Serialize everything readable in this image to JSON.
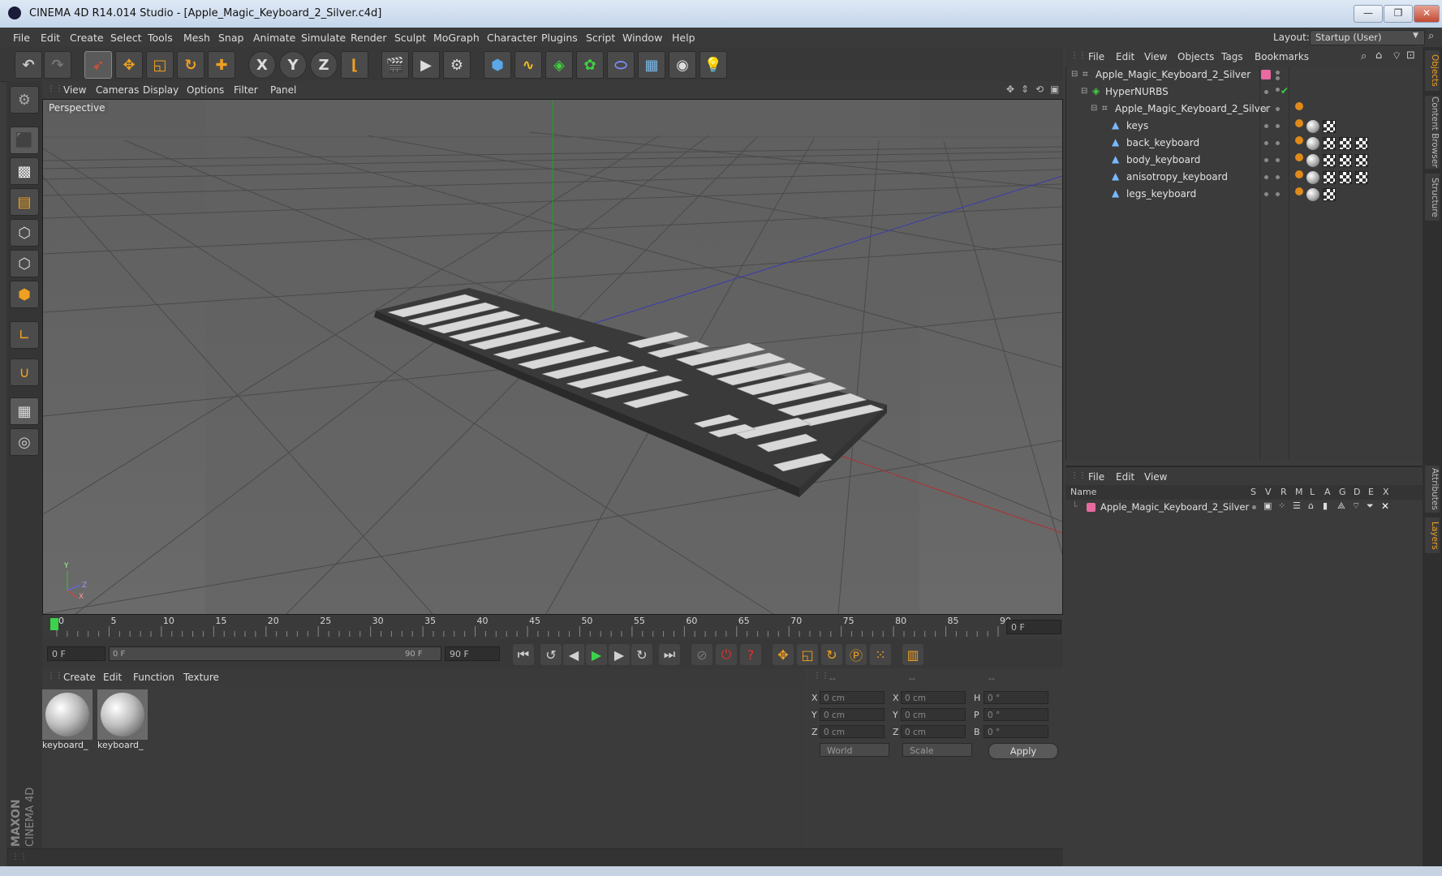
{
  "window": {
    "title": "CINEMA 4D R14.014 Studio - [Apple_Magic_Keyboard_2_Silver.c4d]",
    "controls": {
      "minimize": "—",
      "restore": "❐",
      "close": "✕"
    }
  },
  "menubar": {
    "items": [
      "File",
      "Edit",
      "Create",
      "Select",
      "Tools",
      "Mesh",
      "Snap",
      "Animate",
      "Simulate",
      "Render",
      "Sculpt",
      "MoGraph",
      "Character",
      "Plugins",
      "Script",
      "Window",
      "Help"
    ],
    "layout_label": "Layout:",
    "layout_value": "Startup (User)"
  },
  "toolbar": {
    "axis_x": "X",
    "axis_y": "Y",
    "axis_z": "Z"
  },
  "viewport": {
    "menu": [
      "View",
      "Cameras",
      "Display",
      "Options",
      "Filter",
      "Panel"
    ],
    "label": "Perspective",
    "axis_y": "Y",
    "axis_z": "Z",
    "axis_x": "X"
  },
  "timeline": {
    "ticks": [
      "0",
      "5",
      "10",
      "15",
      "20",
      "25",
      "30",
      "35",
      "40",
      "45",
      "50",
      "55",
      "60",
      "65",
      "70",
      "75",
      "80",
      "85",
      "90"
    ],
    "current_frame": "0 F",
    "start_field": "0 F",
    "range_start": "0 F",
    "range_end": "90 F",
    "end_field": "90 F",
    "progress": 0
  },
  "materials": {
    "menu": [
      "Create",
      "Edit",
      "Function",
      "Texture"
    ],
    "items": [
      {
        "label": "keyboard_"
      },
      {
        "label": "keyboard_"
      }
    ]
  },
  "coordinates": {
    "headers": [
      "--",
      "--",
      "--"
    ],
    "rows": [
      {
        "l1": "X",
        "v1": "0 cm",
        "l2": "X",
        "v2": "0 cm",
        "l3": "H",
        "v3": "0 °"
      },
      {
        "l1": "Y",
        "v1": "0 cm",
        "l2": "Y",
        "v2": "0 cm",
        "l3": "P",
        "v3": "0 °"
      },
      {
        "l1": "Z",
        "v1": "0 cm",
        "l2": "Z",
        "v2": "0 cm",
        "l3": "B",
        "v3": "0 °"
      }
    ],
    "space": "World",
    "mode": "Scale",
    "apply": "Apply"
  },
  "objects": {
    "menu": [
      "File",
      "Edit",
      "View",
      "Objects",
      "Tags",
      "Bookmarks"
    ],
    "tree": [
      {
        "name": "Apple_Magic_Keyboard_2_Silver"
      },
      {
        "name": "HyperNURBS"
      },
      {
        "name": "Apple_Magic_Keyboard_2_Silver"
      },
      {
        "name": "keys"
      },
      {
        "name": "back_keyboard"
      },
      {
        "name": "body_keyboard"
      },
      {
        "name": "anisotropy_keyboard"
      },
      {
        "name": "legs_keyboard"
      }
    ]
  },
  "layers": {
    "menu": [
      "File",
      "Edit",
      "View"
    ],
    "columns": [
      "Name",
      "S",
      "V",
      "R",
      "M",
      "L",
      "A",
      "G",
      "D",
      "E",
      "X"
    ],
    "rows": [
      {
        "name": "Apple_Magic_Keyboard_2_Silver"
      }
    ]
  },
  "sidetabs": [
    "Objects",
    "Content Browser",
    "Structure",
    "Attributes",
    "Layers"
  ],
  "branding": {
    "line1": "MAXON",
    "line2": "CINEMA 4D"
  },
  "colors": {
    "layer_color": "#e86aa0",
    "accent_orange": "#f0a020",
    "timeline_marker": "#3cd24a"
  }
}
